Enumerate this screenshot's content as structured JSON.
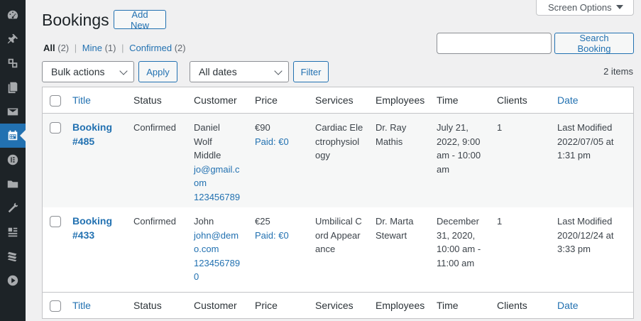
{
  "sidebar": {
    "icons": [
      "dashboard-icon",
      "pin-icon",
      "media-icon",
      "pages-icon",
      "mail-icon",
      "calendar-icon",
      "elementor-icon",
      "folder-icon",
      "tools-icon",
      "settings-icon",
      "stack-icon",
      "play-icon"
    ],
    "active_color": "#2271b1",
    "background": "#1d2327"
  },
  "header": {
    "title": "Bookings",
    "add_new": "Add New",
    "screen_options": "Screen Options"
  },
  "views": {
    "all_label": "All",
    "all_count": "(2)",
    "mine_label": "Mine",
    "mine_count": "(1)",
    "confirmed_label": "Confirmed",
    "confirmed_count": "(2)",
    "separator": "|"
  },
  "search": {
    "value": "",
    "button": "Search Booking"
  },
  "filters": {
    "bulk_actions": "Bulk actions",
    "apply": "Apply",
    "dates": "All dates",
    "filter": "Filter",
    "items_count": "2 items"
  },
  "table": {
    "columns": {
      "title": "Title",
      "status": "Status",
      "customer": "Customer",
      "price": "Price",
      "services": "Services",
      "employees": "Employees",
      "time": "Time",
      "clients": "Clients",
      "date": "Date"
    },
    "rows": [
      {
        "title": "Booking #485",
        "status": "Confirmed",
        "customer_name": "Daniel Wolf Middle",
        "customer_email": "jo@gmail.com",
        "customer_phone": "123456789",
        "price": "€90",
        "paid": "Paid: €0",
        "service": "Cardiac Electrophysiology",
        "employee": "Dr. Ray Mathis",
        "time": "July 21, 2022, 9:00 am - 10:00 am",
        "clients": "1",
        "date": "Last Modified 2022/07/05 at 1:31 pm"
      },
      {
        "title": "Booking #433",
        "status": "Confirmed",
        "customer_name": "John",
        "customer_email": "john@demo.com",
        "customer_phone": "1234567890",
        "price": "€25",
        "paid": "Paid: €0",
        "service": "Umbilical Cord Appearance",
        "employee": "Dr. Marta Stewart",
        "time": "December 31, 2020, 10:00 am - 11:00 am",
        "clients": "1",
        "date": "Last Modified 2020/12/24 at 3:33 pm"
      }
    ]
  }
}
